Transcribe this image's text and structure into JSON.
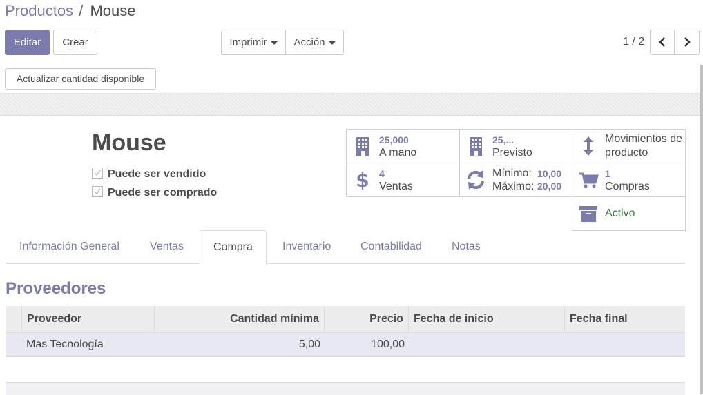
{
  "breadcrumb": {
    "parent": "Productos",
    "separator": "/",
    "current": "Mouse"
  },
  "toolbar": {
    "edit_label": "Editar",
    "create_label": "Crear",
    "print_label": "Imprimir",
    "action_label": "Acción"
  },
  "pager": {
    "value": "1 / 2"
  },
  "header": {
    "update_qty_label": "Actualizar cantidad disponible"
  },
  "product": {
    "name": "Mouse",
    "can_be_sold_label": "Puede ser vendido",
    "can_be_sold": true,
    "can_be_purchased_label": "Puede ser comprado",
    "can_be_purchased": true
  },
  "smart_buttons": {
    "on_hand": {
      "value": "25,000",
      "label": "A mano",
      "icon": "building-icon"
    },
    "forecast": {
      "value": "25,...",
      "label": "Previsto",
      "icon": "building-icon"
    },
    "moves": {
      "label_line1": "Movimientos de",
      "label_line2": "producto",
      "icon": "vertical-arrows-icon"
    },
    "sales": {
      "value": "4",
      "label": "Ventas",
      "icon": "dollar-icon"
    },
    "reordering": {
      "min_label": "Mínimo:",
      "min_value": "10,00",
      "max_label": "Máximo:",
      "max_value": "20,00",
      "icon": "refresh-icon"
    },
    "purchases": {
      "value": "1",
      "label": "Compras",
      "icon": "shopping-cart-icon"
    },
    "active": {
      "label": "Activo",
      "icon": "archive-icon"
    }
  },
  "tabs": [
    {
      "label": "Información General",
      "active": false
    },
    {
      "label": "Ventas",
      "active": false
    },
    {
      "label": "Compra",
      "active": true
    },
    {
      "label": "Inventario",
      "active": false
    },
    {
      "label": "Contabilidad",
      "active": false
    },
    {
      "label": "Notas",
      "active": false
    }
  ],
  "vendors": {
    "title": "Proveedores",
    "columns": [
      "Proveedor",
      "Cantidad mínima",
      "Precio",
      "Fecha de inicio",
      "Fecha final"
    ],
    "rows": [
      {
        "vendor": "Mas Tecnología",
        "min_qty": "5,00",
        "price": "100,00",
        "date_start": "",
        "date_end": ""
      }
    ]
  },
  "colors": {
    "brand": "#7c7bad",
    "active_green": "#3c763d",
    "text": "#4c4c4c"
  }
}
